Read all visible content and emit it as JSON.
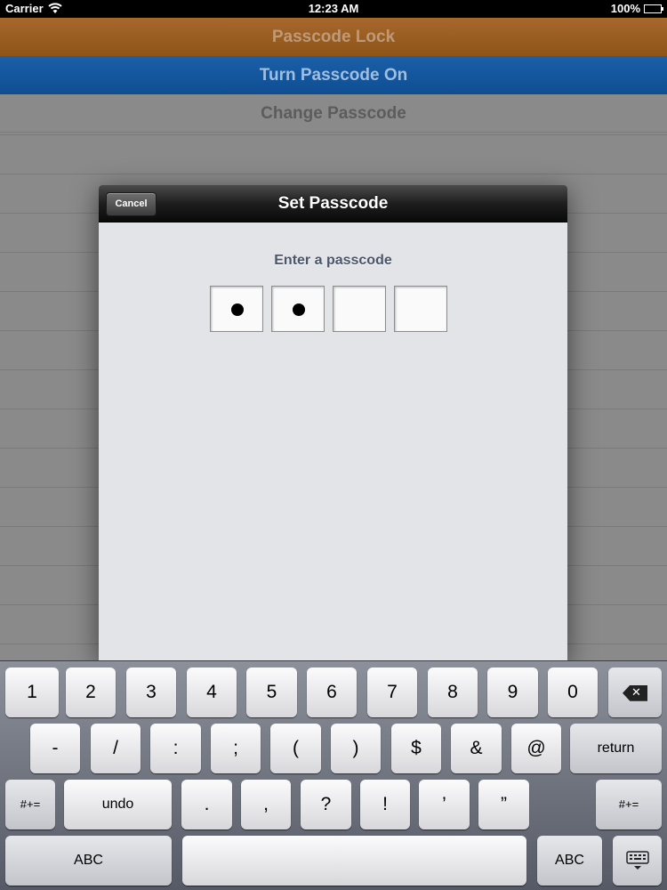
{
  "status_bar": {
    "carrier": "Carrier",
    "time": "12:23 AM",
    "battery": "100%"
  },
  "background_list": {
    "rows": [
      {
        "label": "Passcode Lock"
      },
      {
        "label": "Turn Passcode On"
      },
      {
        "label": "Change Passcode"
      }
    ]
  },
  "modal": {
    "title": "Set Passcode",
    "cancel_label": "Cancel",
    "prompt": "Enter a passcode",
    "digits_entered": 2,
    "digits_total": 4
  },
  "keyboard": {
    "row1": [
      "1",
      "2",
      "3",
      "4",
      "5",
      "6",
      "7",
      "8",
      "9",
      "0"
    ],
    "row2": [
      "-",
      "/",
      ":",
      ";",
      "(",
      ")",
      "$",
      "&",
      "@"
    ],
    "return_label": "return",
    "row3_left": "#+=",
    "undo_label": "undo",
    "row3": [
      ".",
      ",",
      "?",
      "!",
      "’",
      "”"
    ],
    "row3_right": "#+=",
    "abc_left": "ABC",
    "abc_right": "ABC",
    "delete_icon": "backspace-icon",
    "dismiss_icon": "keyboard-dismiss-icon"
  }
}
